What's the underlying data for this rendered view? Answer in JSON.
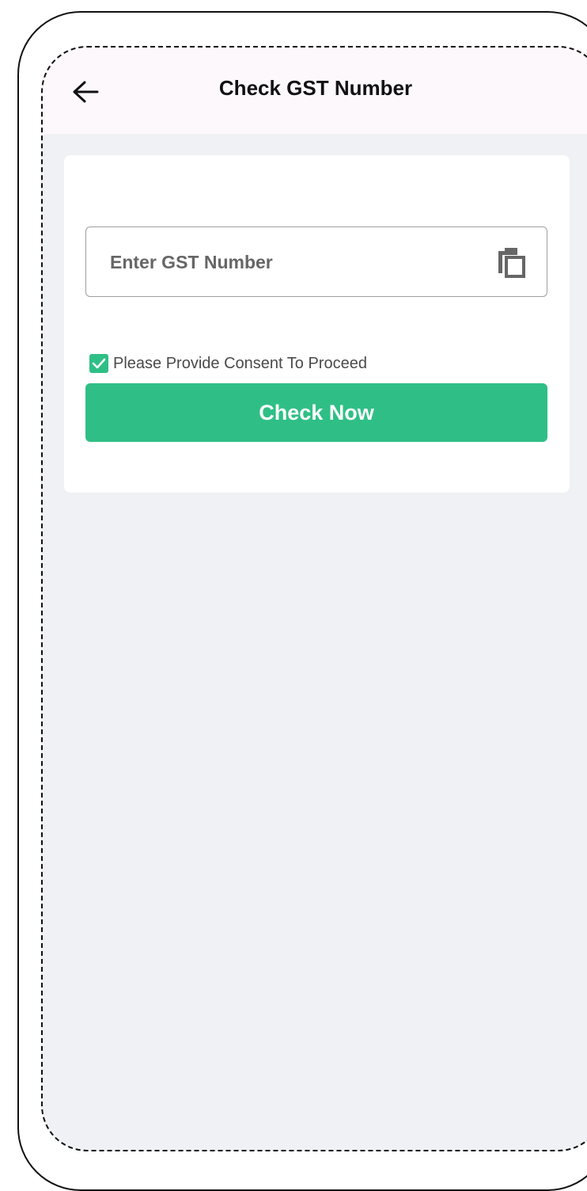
{
  "header": {
    "back_icon": "arrow-left-icon",
    "title": "Check GST Number"
  },
  "form": {
    "gst_input": {
      "placeholder": "Enter GST Number",
      "value": ""
    },
    "paste_icon": "copy-paste-icon",
    "consent": {
      "checked": true,
      "label": "Please Provide Consent To Proceed"
    },
    "submit_label": "Check Now"
  },
  "colors": {
    "accent": "#2fbf86",
    "header_bg": "#fdf8fc",
    "page_bg": "#f0f1f5"
  }
}
